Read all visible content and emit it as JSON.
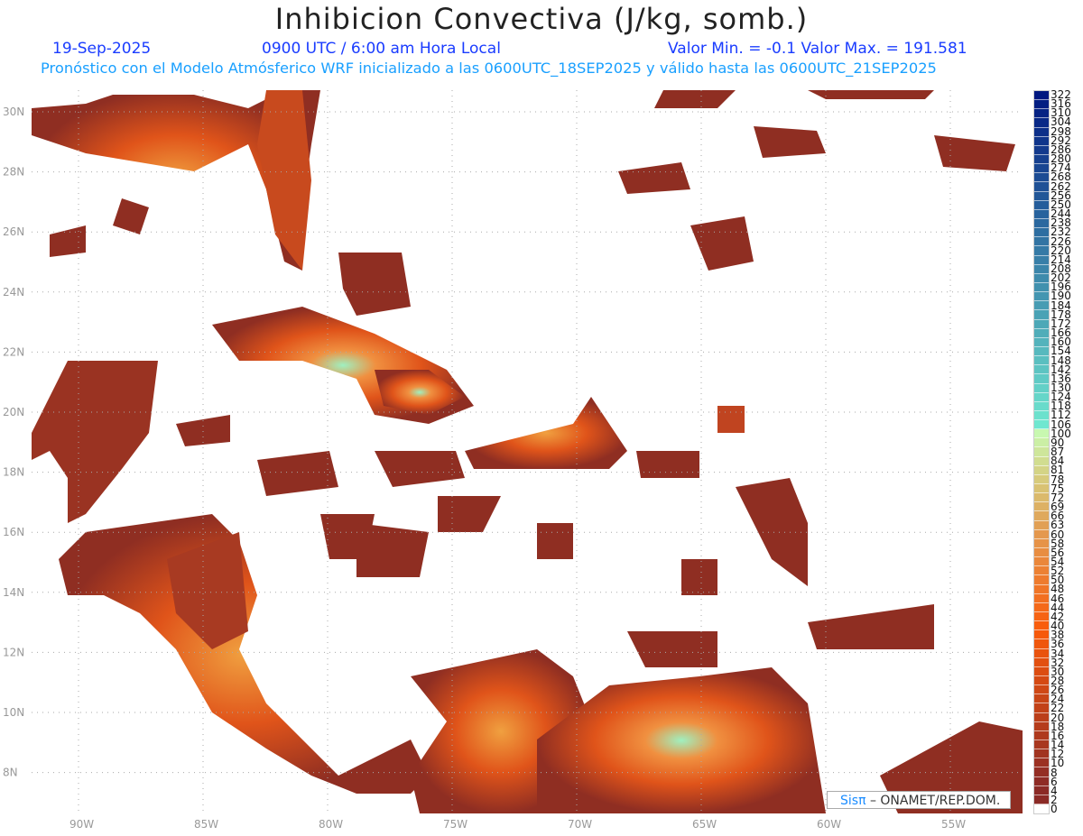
{
  "header": {
    "title": "Inhibicion Convectiva (J/kg, somb.)",
    "date": "19-Sep-2025",
    "time": "0900 UTC / 6:00 am Hora Local",
    "minmax": "Valor Min. = -0.1  Valor Max. = 191.581",
    "model_info": "Pronóstico con el Modelo Atmósferico WRF inicializado a las 0600UTC_18SEP2025 y válido hasta las  0600UTC_21SEP2025"
  },
  "axes": {
    "lon_labels": [
      "90W",
      "85W",
      "80W",
      "75W",
      "70W",
      "65W",
      "60W",
      "55W"
    ],
    "lat_labels": [
      "30N",
      "28N",
      "26N",
      "24N",
      "22N",
      "20N",
      "18N",
      "16N",
      "14N",
      "12N",
      "10N",
      "8N"
    ]
  },
  "colorbar": {
    "labels": [
      "322",
      "316",
      "310",
      "304",
      "298",
      "292",
      "286",
      "280",
      "274",
      "268",
      "262",
      "256",
      "250",
      "244",
      "238",
      "232",
      "226",
      "220",
      "214",
      "208",
      "202",
      "196",
      "190",
      "184",
      "178",
      "172",
      "166",
      "160",
      "154",
      "148",
      "142",
      "136",
      "130",
      "124",
      "118",
      "112",
      "106",
      "100",
      "90",
      "87",
      "84",
      "81",
      "78",
      "75",
      "72",
      "69",
      "66",
      "63",
      "60",
      "58",
      "56",
      "54",
      "52",
      "50",
      "48",
      "46",
      "44",
      "42",
      "40",
      "38",
      "36",
      "34",
      "32",
      "30",
      "28",
      "26",
      "24",
      "22",
      "20",
      "18",
      "16",
      "14",
      "12",
      "10",
      "8",
      "6",
      "4",
      "2",
      "0"
    ],
    "colors": {
      "low": "#8b2a26",
      "mid": "#f95a0a",
      "orange_light": "#e39a50",
      "yellow": "#d8c878",
      "green": "#c8f8b0",
      "cyan": "#70e8d0",
      "blue": "#1a88f8",
      "navy": "#001880"
    }
  },
  "credit": {
    "logo": "Sisπ",
    "text": "– ONAMET/REP.DOM."
  }
}
